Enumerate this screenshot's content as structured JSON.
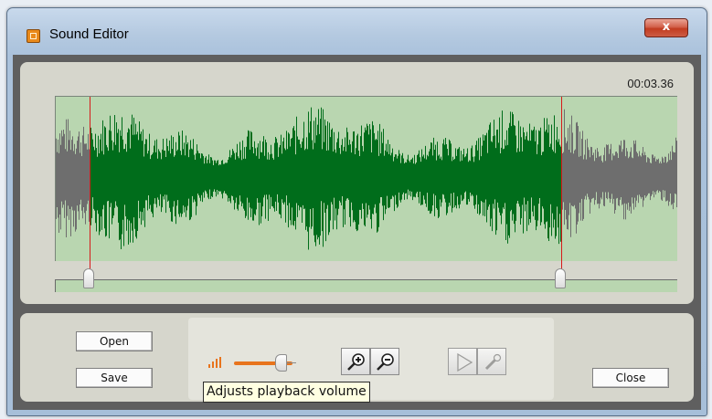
{
  "window": {
    "title": "Sound Editor",
    "close_glyph": "x"
  },
  "waveform": {
    "time": "00:03.36",
    "selection": {
      "start_fraction": 0.054,
      "end_fraction": 0.813
    },
    "colors": {
      "selected": "#006d1b",
      "unselected": "#6e6e6e",
      "background": "#b9d6b0",
      "marker": "#d71a1a"
    }
  },
  "buttons": {
    "open": "Open",
    "save": "Save",
    "close": "Close"
  },
  "volume": {
    "level_fraction": 0.7,
    "accent": "#e8741d"
  },
  "tools": {
    "zoom_in": "zoom-in-icon",
    "zoom_out": "zoom-out-icon",
    "play": "play-icon",
    "edit": "pencil-icon"
  },
  "tooltip": {
    "text": "Adjusts playback volume"
  }
}
